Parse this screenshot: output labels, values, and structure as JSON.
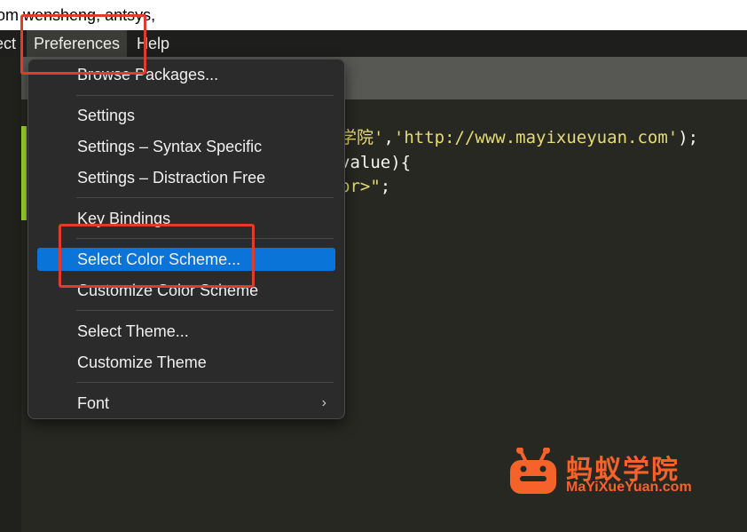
{
  "window": {
    "title": "om wensheng, antsys,"
  },
  "menubar": {
    "items": [
      {
        "label": "ect"
      },
      {
        "label": "Preferences"
      },
      {
        "label": "Help"
      }
    ]
  },
  "editor": {
    "lines": [
      {
        "str1": "学院'",
        "plain1": ",",
        "str2": "'http://www.mayixueyuan.com'",
        "plain2": ");"
      },
      {
        "plain1": "value){"
      },
      {
        "str1": "br>\"",
        "plain1": ";"
      }
    ]
  },
  "dropdown": {
    "items": [
      {
        "label": "Browse Packages..."
      },
      {
        "label": "Settings"
      },
      {
        "label": "Settings – Syntax Specific"
      },
      {
        "label": "Settings – Distraction Free"
      },
      {
        "label": "Key Bindings"
      },
      {
        "label": "Select Color Scheme..."
      },
      {
        "label": "Customize Color Scheme"
      },
      {
        "label": "Select Theme..."
      },
      {
        "label": "Customize Theme"
      },
      {
        "label": "Font"
      }
    ],
    "selected_index": 5,
    "submenu_chevron": "›"
  },
  "watermark": {
    "chinese": "蚂蚁学院",
    "url": "MaYiXueYuan.com"
  },
  "colors": {
    "editor_bg": "#272822",
    "menu_bg": "#2b2b2b",
    "highlight": "#0a74d8",
    "string": "#e6db74",
    "annotation_red": "#e23b2b",
    "brand_orange": "#f5622a"
  }
}
